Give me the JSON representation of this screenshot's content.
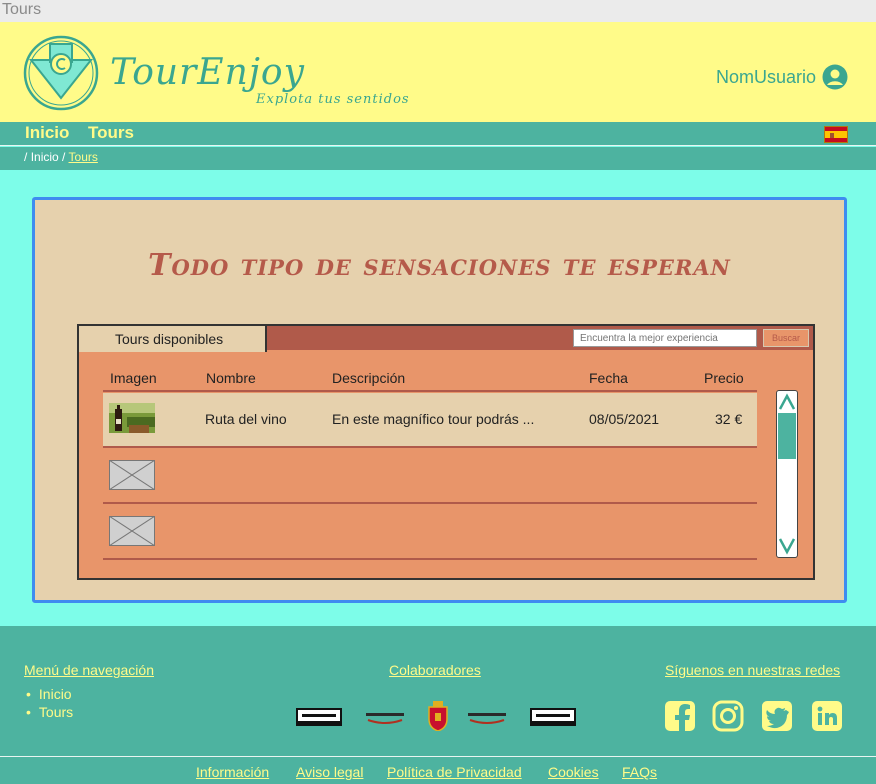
{
  "window": {
    "title": "Tours"
  },
  "header": {
    "brand": "TourEnjoy",
    "tagline": "Explota tus sentidos",
    "user_name": "NomUsuario"
  },
  "nav": {
    "items": [
      "Inicio",
      "Tours"
    ],
    "language": "es"
  },
  "breadcrumb": {
    "sep": "/",
    "home": "Inicio",
    "current": "Tours"
  },
  "main": {
    "headline": "Todo tipo de sensaciones te esperan",
    "tab_label": "Tours disponibles",
    "search_placeholder": "Encuentra la mejor experiencia",
    "search_button": "Buscar",
    "columns": [
      "Imagen",
      "Nombre",
      "Descripción",
      "Fecha",
      "Precio"
    ],
    "rows": [
      {
        "name": "Ruta del vino",
        "description": "En este magnífico tour podrás ...",
        "date": "08/05/2021",
        "price": "32 €",
        "image": "wine-photo"
      },
      {
        "name": "",
        "description": "",
        "date": "",
        "price": "",
        "image": "placeholder"
      },
      {
        "name": "",
        "description": "",
        "date": "",
        "price": "",
        "image": "placeholder"
      }
    ]
  },
  "footer": {
    "nav_title": "Menú de navegación",
    "nav_links": [
      "Inicio",
      "Tours"
    ],
    "collab_title": "Colaboradores",
    "collaborators": [
      "Manzano",
      "PuyduFou",
      "escudo",
      "PuyduFou",
      "Manzano"
    ],
    "social_title": "Síguenos en nuestras redes",
    "social": [
      "facebook-icon",
      "instagram-icon",
      "twitter-icon",
      "linkedin-icon"
    ],
    "bottom_links": [
      "Información",
      "Aviso legal",
      "Política de Privacidad",
      "Cookies",
      "FAQs"
    ]
  },
  "colors": {
    "header_bg": "#fffb89",
    "teal": "#4db3a0",
    "page_bg": "#7dfde9",
    "panel_bg": "#e6d1ad",
    "accent": "#b55a4a"
  }
}
